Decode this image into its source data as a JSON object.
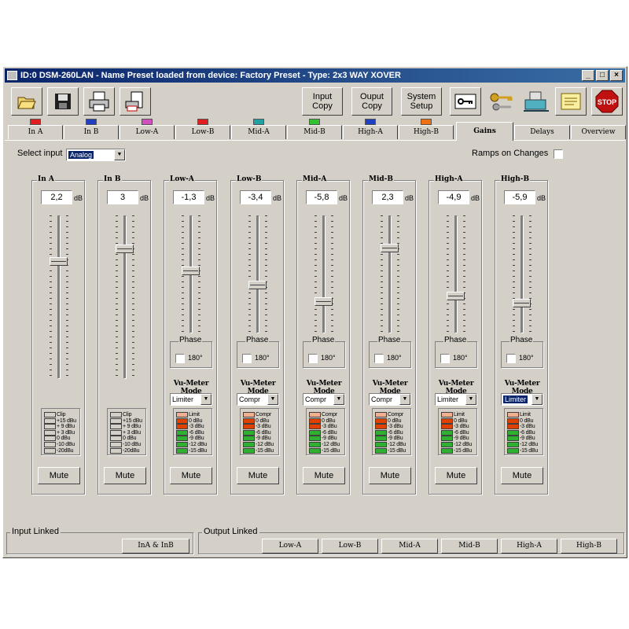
{
  "window": {
    "title": "ID:0 DSM-260LAN - Name Preset loaded from device: Factory Preset - Type: 2x3 WAY XOVER"
  },
  "toolbar": {
    "icon_buttons": [
      {
        "name": "open-icon"
      },
      {
        "name": "save-icon"
      },
      {
        "name": "print-icon"
      },
      {
        "name": "print-preview-icon"
      }
    ],
    "text_buttons": [
      "Input\nCopy",
      "Ouput\nCopy",
      "System\nSetup"
    ],
    "right_icons": [
      {
        "name": "key-icon"
      },
      {
        "name": "keys-icon"
      },
      {
        "name": "network-icon"
      },
      {
        "name": "notes-icon"
      },
      {
        "name": "stop-icon"
      }
    ],
    "stop_label": "STOP"
  },
  "tabs": [
    {
      "label": "In A",
      "color": "#e02020"
    },
    {
      "label": "In B",
      "color": "#2040c0"
    },
    {
      "label": "Low-A",
      "color": "#d050c0"
    },
    {
      "label": "Low-B",
      "color": "#e02020"
    },
    {
      "label": "Mid-A",
      "color": "#20a0a0"
    },
    {
      "label": "Mid-B",
      "color": "#30c030"
    },
    {
      "label": "High-A",
      "color": "#2040c0"
    },
    {
      "label": "High-B",
      "color": "#f07010"
    },
    {
      "label": "Gains",
      "color": null,
      "active": true
    },
    {
      "label": "Delays",
      "color": null
    },
    {
      "label": "Overview",
      "color": null
    }
  ],
  "select_input": {
    "label": "Select input",
    "value": "Analog"
  },
  "ramps": {
    "label": "Ramps on Changes",
    "checked": false
  },
  "channels": [
    {
      "name": "In A",
      "value": "2,2",
      "unit": "dB",
      "level": 0.73,
      "type": "input"
    },
    {
      "name": "In B",
      "value": "3",
      "unit": "dB",
      "level": 0.81,
      "type": "input"
    },
    {
      "name": "Low-A",
      "value": "-1,3",
      "unit": "dB",
      "level": 0.53,
      "type": "output",
      "mode": "Limiter"
    },
    {
      "name": "Low-B",
      "value": "-3,4",
      "unit": "dB",
      "level": 0.4,
      "type": "output",
      "mode": "Compr"
    },
    {
      "name": "Mid-A",
      "value": "-5,8",
      "unit": "dB",
      "level": 0.25,
      "type": "output",
      "mode": "Compr"
    },
    {
      "name": "Mid-B",
      "value": "2,3",
      "unit": "dB",
      "level": 0.74,
      "type": "output",
      "mode": "Compr"
    },
    {
      "name": "High-A",
      "value": "-4,9",
      "unit": "dB",
      "level": 0.3,
      "type": "output",
      "mode": "Limiter"
    },
    {
      "name": "High-B",
      "value": "-5,9",
      "unit": "dB",
      "level": 0.24,
      "type": "output",
      "mode": "Limiter",
      "mode_selected": true
    }
  ],
  "phase": {
    "label": "Phase",
    "option": "180°"
  },
  "vu_mode_label": "Vu-Meter Mode",
  "input_meter_labels": [
    "Clip",
    "+15 dBu",
    "+ 9 dBu",
    "+ 3 dBu",
    "0 dBu",
    "-10 dBu",
    "-20dBu"
  ],
  "output_meter_labels": [
    "Limit",
    "0 dBu",
    "-3 dBu",
    "-6 dBu",
    "-9 dBu",
    "-12 dBu",
    "-15 dBu"
  ],
  "output_meter_labels_compr": [
    "Compr",
    "0 dBu",
    "-3 dBu",
    "-6 dBu",
    "-9 dBu",
    "-12 dBu",
    "-15 dBu"
  ],
  "meter_colors": {
    "limit": "#f0b090",
    "red": "#e04000",
    "green": "#30b030",
    "empty": "#d4d0c8"
  },
  "mute_label": "Mute",
  "input_linked": {
    "label": "Input Linked",
    "button": "InA & InB"
  },
  "output_linked": {
    "label": "Output Linked",
    "buttons": [
      "Low-A",
      "Low-B",
      "Mid-A",
      "Mid-B",
      "High-A",
      "High-B"
    ]
  }
}
